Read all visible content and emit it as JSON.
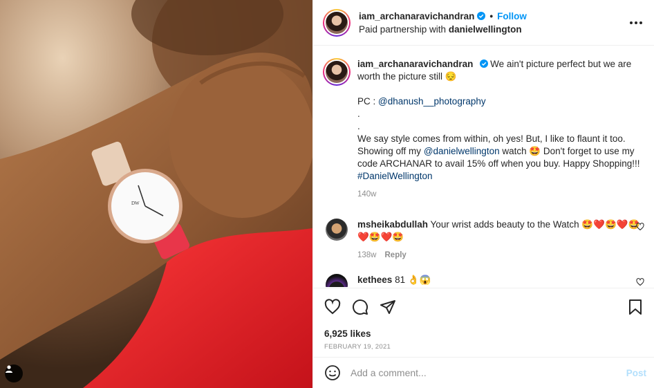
{
  "post": {
    "username": "iam_archanaravichandran",
    "follow_label": "Follow",
    "separator": "•",
    "partnership_prefix": "Paid partnership with ",
    "partner": "danielwellington",
    "more_icon": "more-horizontal-icon",
    "verified_color": "#0095f6"
  },
  "caption": {
    "username": "iam_archanaravichandran",
    "line1": "We ain't picture perfect but we are worth the picture still 😔",
    "pc_label": "PC : ",
    "pc_handle": "@dhanush__photography",
    "dot1": ".",
    "dot2": ".",
    "text_a": "We say style comes from within, oh yes! But, I like to flaunt it too. Showing off my ",
    "mention": "@danielwellington",
    "text_b": " watch 🤩 Don't forget to use my code ARCHANAR to avail 15% off when you buy. Happy Shopping!!! ",
    "hashtag": "#DanielWellington",
    "time": "140w"
  },
  "comments": [
    {
      "username": "msheikabdullah",
      "text": "Your wrist adds beauty to the Watch 🤩❤️🤩❤️🤩❤️🤩❤️🤩",
      "time": "138w",
      "reply_label": "Reply"
    },
    {
      "username": "kethees",
      "text": "81 👌😱"
    }
  ],
  "actions": {
    "likes": "6,925 likes",
    "date": "FEBRUARY 19, 2021"
  },
  "composer": {
    "placeholder": "Add a comment...",
    "post_label": "Post"
  },
  "colors": {
    "accent": "#0095f6",
    "link": "#00376b",
    "muted": "#8e8e8e",
    "post_disabled": "#b2dffc"
  }
}
